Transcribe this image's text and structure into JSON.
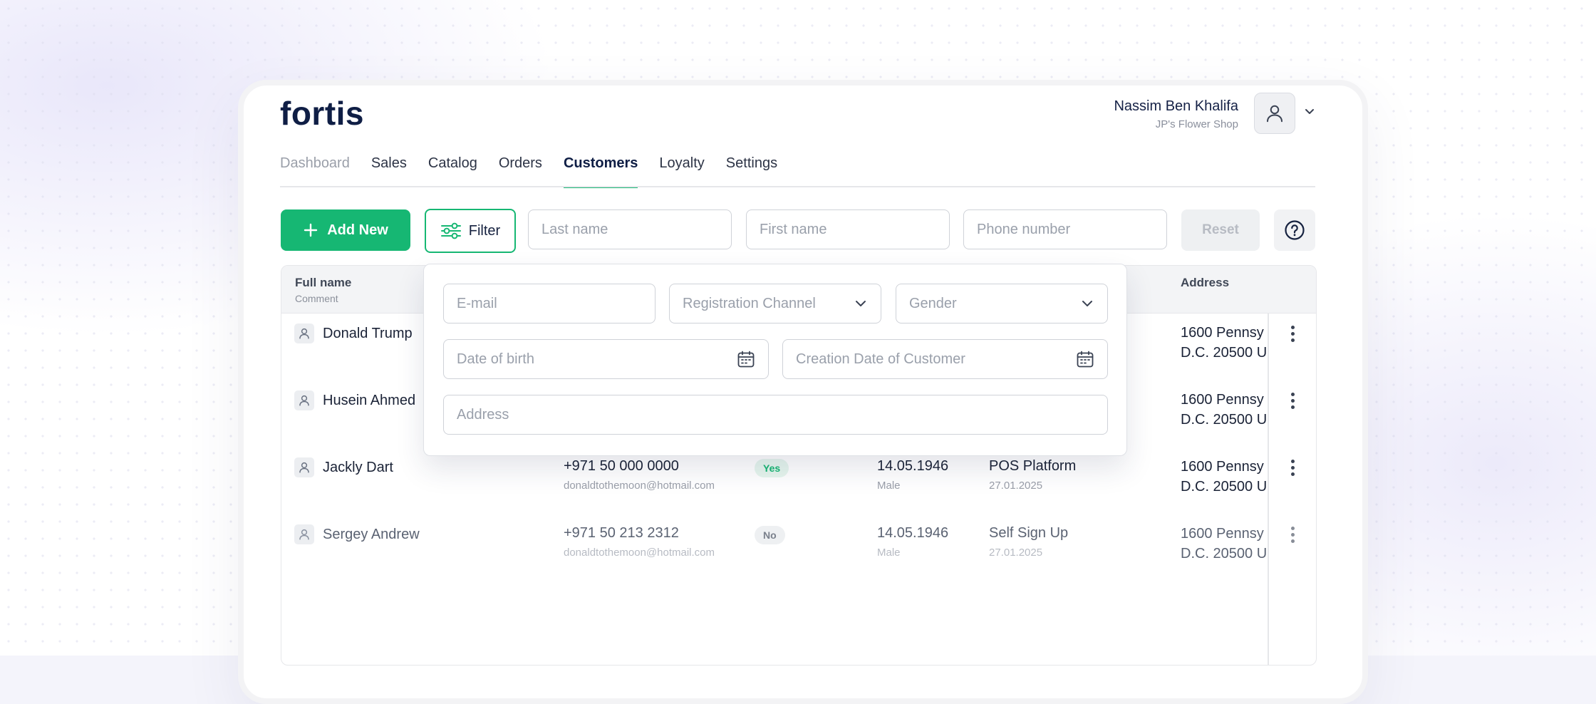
{
  "app": {
    "logo": "fortis"
  },
  "user": {
    "name": "Nassim Ben Khalifa",
    "shop": "JP's Flower Shop"
  },
  "nav": {
    "tabs": [
      {
        "label": "Dashboard"
      },
      {
        "label": "Sales"
      },
      {
        "label": "Catalog"
      },
      {
        "label": "Orders"
      },
      {
        "label": "Customers"
      },
      {
        "label": "Loyalty"
      },
      {
        "label": "Settings"
      }
    ],
    "active": "Customers"
  },
  "toolbar": {
    "add_label": "Add New",
    "filter_label": "Filter",
    "last_name_placeholder": "Last name",
    "first_name_placeholder": "First name",
    "phone_placeholder": "Phone number",
    "reset_label": "Reset"
  },
  "filter_panel": {
    "email_placeholder": "E-mail",
    "registration_channel_placeholder": "Registration Channel",
    "gender_placeholder": "Gender",
    "dob_placeholder": "Date of birth",
    "creation_date_placeholder": "Creation Date of Customer",
    "address_placeholder": "Address"
  },
  "table": {
    "headers": {
      "full_name": "Full name",
      "comment": "Comment",
      "address": "Address"
    },
    "rows": [
      {
        "name": "Donald Trump",
        "phone": "",
        "email": "",
        "subscribed": "",
        "dob": "",
        "gender": "",
        "channel": "",
        "created": "",
        "address_line1": "1600 Pennsy",
        "address_line2": "D.C. 20500 U"
      },
      {
        "name": "Husein Ahmed",
        "phone": "",
        "email": "",
        "subscribed": "",
        "dob": "",
        "gender": "",
        "channel": "",
        "created": "",
        "address_line1": "1600 Pennsy",
        "address_line2": "D.C. 20500 U"
      },
      {
        "name": "Jackly Dart",
        "phone": "+971 50 000 0000",
        "email": "donaldtothemoon@hotmail.com",
        "subscribed": "Yes",
        "dob": "14.05.1946",
        "gender": "Male",
        "channel": "POS Platform",
        "created": "27.01.2025",
        "address_line1": "1600 Pennsy",
        "address_line2": "D.C. 20500 U"
      },
      {
        "name": "Sergey Andrew",
        "phone": "+971 50 213 2312",
        "email": "donaldtothemoon@hotmail.com",
        "subscribed": "No",
        "dob": "14.05.1946",
        "gender": "Male",
        "channel": "Self Sign Up",
        "created": "27.01.2025",
        "address_line1": "1600 Pennsy",
        "address_line2": "D.C. 20500 U"
      }
    ]
  },
  "colors": {
    "brand": "#16b773",
    "navy": "#0f1e45"
  }
}
